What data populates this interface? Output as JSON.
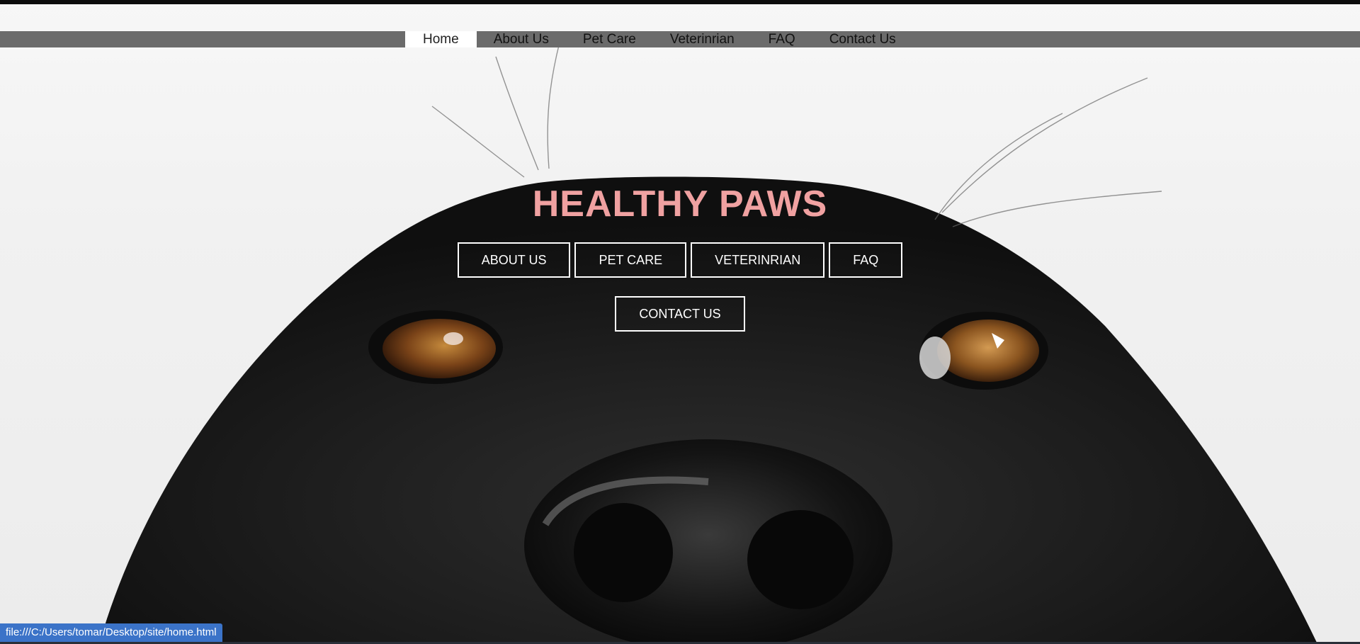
{
  "nav": {
    "items": [
      {
        "label": "Home",
        "active": true
      },
      {
        "label": "About Us",
        "active": false
      },
      {
        "label": "Pet Care",
        "active": false
      },
      {
        "label": "Veterinrian",
        "active": false
      },
      {
        "label": "FAQ",
        "active": false
      },
      {
        "label": "Contact Us",
        "active": false
      }
    ]
  },
  "hero": {
    "title": "HEALTHY PAWS",
    "buttons_row1": [
      "ABOUT US",
      "PET CARE",
      "VETERINRIAN",
      "FAQ"
    ],
    "buttons_row2": [
      "CONTACT US"
    ],
    "background_image": "black-dog-closeup"
  },
  "status_bar": {
    "url": "file:///C:/Users/tomar/Desktop/site/home.html"
  },
  "colors": {
    "nav_bar": "#6b6b6b",
    "nav_active": "#ffffff",
    "title": "#f0a1a1",
    "button_border": "#ffffff",
    "status_bar": "#3b73c8"
  }
}
